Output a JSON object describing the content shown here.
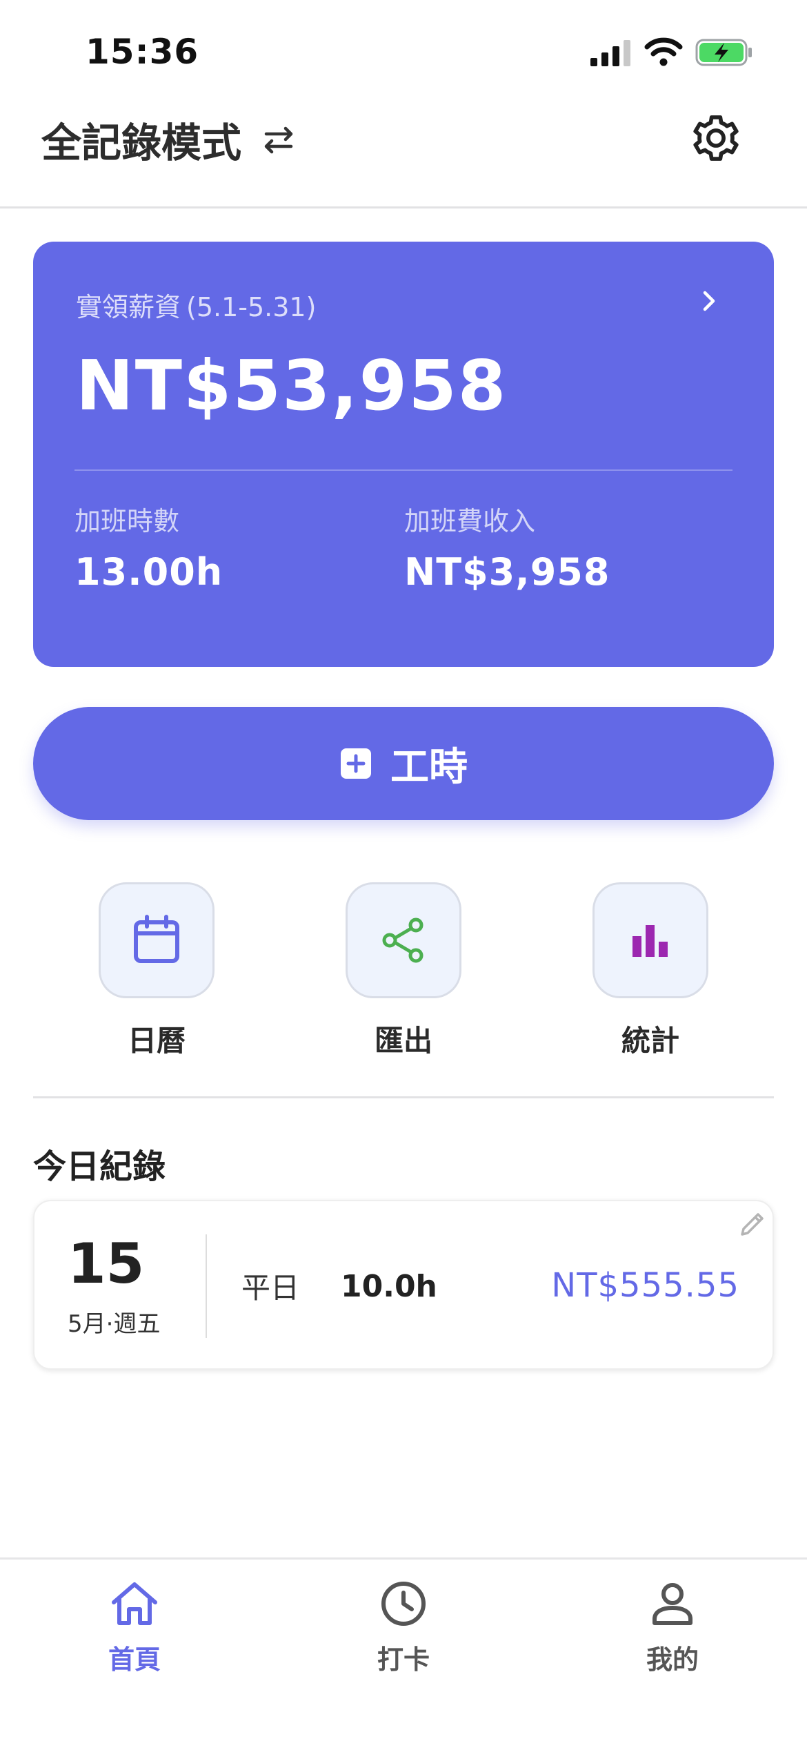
{
  "status_bar": {
    "time": "15:36"
  },
  "header": {
    "title": "全記錄模式"
  },
  "salary_card": {
    "label": "實領薪資",
    "range": "(5.1-5.31)",
    "amount": "NT$53,958",
    "overtime_hours_label": "加班時數",
    "overtime_hours_value": "13.00h",
    "overtime_pay_label": "加班費收入",
    "overtime_pay_value": "NT$3,958"
  },
  "add_button": {
    "label": "工時"
  },
  "actions": [
    {
      "label": "日曆",
      "icon": "calendar-icon",
      "color": "#6369e6"
    },
    {
      "label": "匯出",
      "icon": "share-icon",
      "color": "#4caf50"
    },
    {
      "label": "統計",
      "icon": "bar-chart-icon",
      "color": "#9c27b0"
    }
  ],
  "today": {
    "title": "今日紀錄",
    "record": {
      "day": "15",
      "date": "5月·週五",
      "type": "平日",
      "hours": "10.0h",
      "amount": "NT$555.55"
    }
  },
  "nav": [
    {
      "label": "首頁",
      "icon": "home-icon",
      "active": true
    },
    {
      "label": "打卡",
      "icon": "clock-icon",
      "active": false
    },
    {
      "label": "我的",
      "icon": "user-icon",
      "active": false
    }
  ],
  "colors": {
    "accent": "#6369e6",
    "text": "#2b2b2b",
    "divider": "#e2e2e4"
  }
}
